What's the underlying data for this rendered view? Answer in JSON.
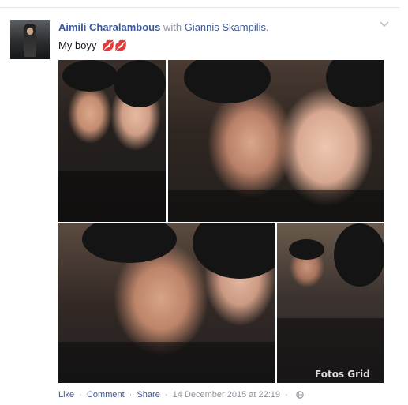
{
  "post": {
    "author": "Aimili Charalambous",
    "with_text": "with",
    "tagged": "Giannis Skampilis.",
    "status_text": "My boyy",
    "status_emoji": "💋💋"
  },
  "photos": {
    "watermark": "Fotos Grid"
  },
  "footer": {
    "like": "Like",
    "comment": "Comment",
    "share": "Share",
    "separator": "·",
    "timestamp": "14 December 2015 at 22:19"
  },
  "icons": {
    "options": "chevron-down-icon",
    "privacy": "globe-icon"
  }
}
